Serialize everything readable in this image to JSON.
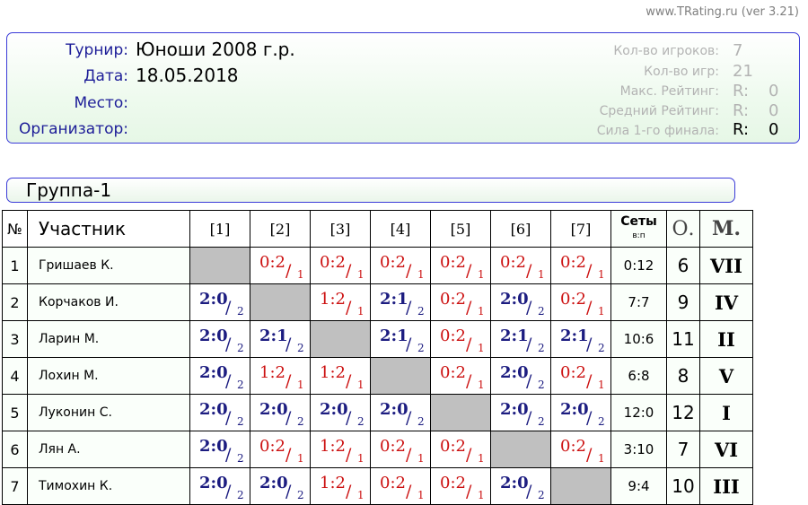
{
  "site": "www.TRating.ru (ver 3.21)",
  "info": {
    "tournament_label": "Турнир:",
    "tournament": "Юноши 2008 г.р.",
    "date_label": "Дата:",
    "date": "18.05.2018",
    "place_label": "Место:",
    "place": "",
    "organizer_label": "Организатор:",
    "organizer": ""
  },
  "stats": {
    "players_label": "Кол-во игроков:",
    "players": "7",
    "games_label": "Кол-во игр:",
    "games": "21",
    "max_rating_label": "Макс. Рейтинг:",
    "max_rating": "0",
    "avg_rating_label": "Средний Рейтинг:",
    "avg_rating": "0",
    "final_strength_label": "Сила 1-го финала:",
    "final_strength": "0",
    "r_prefix": "R:"
  },
  "group": "Группа-1",
  "table": {
    "headers": {
      "num": "№",
      "player": "Участник",
      "sets": "Сеты",
      "sets_sub": "в:п",
      "points": "О.",
      "place": "М."
    },
    "cols": [
      "[1]",
      "[2]",
      "[3]",
      "[4]",
      "[5]",
      "[6]",
      "[7]"
    ],
    "rows": [
      {
        "num": "1",
        "name": "Гришаев К.",
        "sets": "0:12",
        "points": "6",
        "place": "VII",
        "results": [
          null,
          {
            "s": "0:2",
            "p": "1"
          },
          {
            "s": "0:2",
            "p": "1"
          },
          {
            "s": "0:2",
            "p": "1"
          },
          {
            "s": "0:2",
            "p": "1"
          },
          {
            "s": "0:2",
            "p": "1"
          },
          {
            "s": "0:2",
            "p": "1"
          }
        ]
      },
      {
        "num": "2",
        "name": "Корчаков И.",
        "sets": "7:7",
        "points": "9",
        "place": "IV",
        "results": [
          {
            "s": "2:0",
            "p": "2"
          },
          null,
          {
            "s": "1:2",
            "p": "1"
          },
          {
            "s": "2:1",
            "p": "2"
          },
          {
            "s": "0:2",
            "p": "1"
          },
          {
            "s": "2:0",
            "p": "2"
          },
          {
            "s": "0:2",
            "p": "1"
          }
        ]
      },
      {
        "num": "3",
        "name": "Ларин М.",
        "sets": "10:6",
        "points": "11",
        "place": "II",
        "results": [
          {
            "s": "2:0",
            "p": "2"
          },
          {
            "s": "2:1",
            "p": "2"
          },
          null,
          {
            "s": "2:1",
            "p": "2"
          },
          {
            "s": "0:2",
            "p": "1"
          },
          {
            "s": "2:1",
            "p": "2"
          },
          {
            "s": "2:1",
            "p": "2"
          }
        ]
      },
      {
        "num": "4",
        "name": "Лохин М.",
        "sets": "6:8",
        "points": "8",
        "place": "V",
        "results": [
          {
            "s": "2:0",
            "p": "2"
          },
          {
            "s": "1:2",
            "p": "1"
          },
          {
            "s": "1:2",
            "p": "1"
          },
          null,
          {
            "s": "0:2",
            "p": "1"
          },
          {
            "s": "2:0",
            "p": "2"
          },
          {
            "s": "0:2",
            "p": "1"
          }
        ]
      },
      {
        "num": "5",
        "name": "Луконин С.",
        "sets": "12:0",
        "points": "12",
        "place": "I",
        "results": [
          {
            "s": "2:0",
            "p": "2"
          },
          {
            "s": "2:0",
            "p": "2"
          },
          {
            "s": "2:0",
            "p": "2"
          },
          {
            "s": "2:0",
            "p": "2"
          },
          null,
          {
            "s": "2:0",
            "p": "2"
          },
          {
            "s": "2:0",
            "p": "2"
          }
        ]
      },
      {
        "num": "6",
        "name": "Лян А.",
        "sets": "3:10",
        "points": "7",
        "place": "VI",
        "results": [
          {
            "s": "2:0",
            "p": "2"
          },
          {
            "s": "0:2",
            "p": "1"
          },
          {
            "s": "1:2",
            "p": "1"
          },
          {
            "s": "0:2",
            "p": "1"
          },
          {
            "s": "0:2",
            "p": "1"
          },
          null,
          {
            "s": "0:2",
            "p": "1"
          }
        ]
      },
      {
        "num": "7",
        "name": "Тимохин К.",
        "sets": "9:4",
        "points": "10",
        "place": "III",
        "results": [
          {
            "s": "2:0",
            "p": "2"
          },
          {
            "s": "2:0",
            "p": "2"
          },
          {
            "s": "1:2",
            "p": "1"
          },
          {
            "s": "0:2",
            "p": "1"
          },
          {
            "s": "0:2",
            "p": "1"
          },
          {
            "s": "2:0",
            "p": "2"
          },
          null
        ]
      }
    ]
  },
  "colors": {
    "win": "#1c1c80",
    "loss": "#cc1111",
    "border": "#3b3bd8",
    "diag": "#c0c0c0"
  }
}
